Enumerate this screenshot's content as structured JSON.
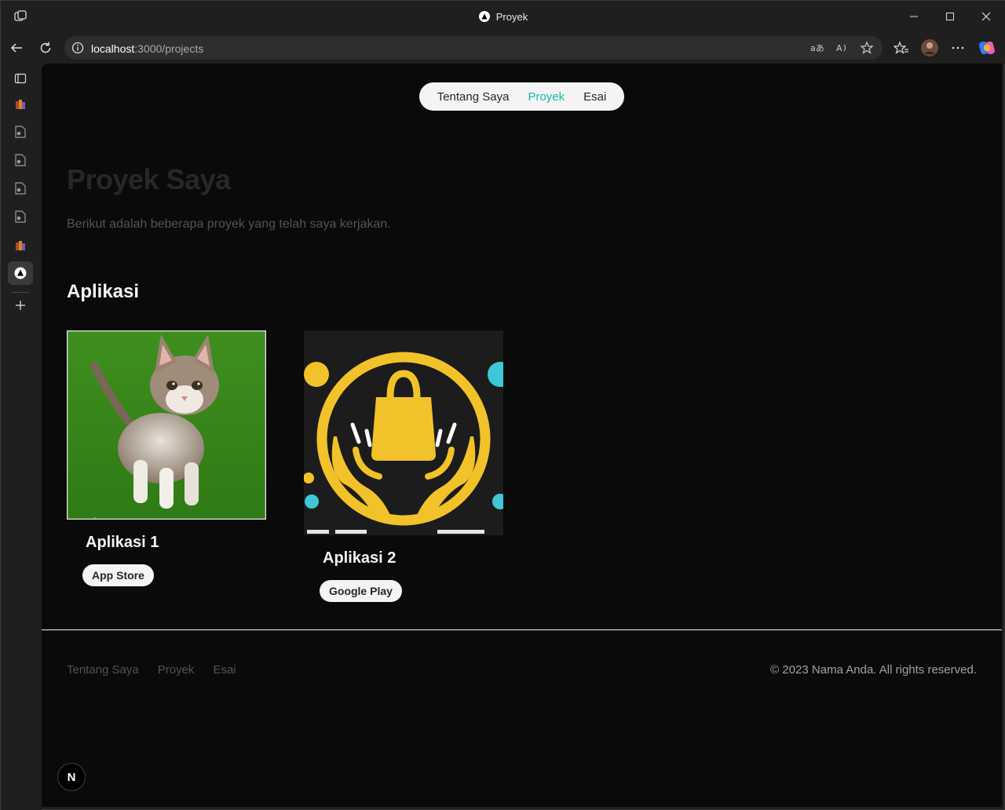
{
  "browser": {
    "tab_title": "Proyek",
    "url_host": "localhost",
    "url_path": ":3000/projects"
  },
  "nav": {
    "items": [
      {
        "label": "Tentang Saya"
      },
      {
        "label": "Proyek",
        "active": true
      },
      {
        "label": "Esai"
      }
    ]
  },
  "hero": {
    "title": "Proyek Saya",
    "description": "Berikut adalah beberapa proyek yang telah saya kerjakan."
  },
  "section": {
    "title": "Aplikasi",
    "cards": [
      {
        "title": "Aplikasi 1",
        "button": "App Store",
        "image": "kitten-photo"
      },
      {
        "title": "Aplikasi 2",
        "button": "Google Play",
        "image": "shopping-bag-hands-logo"
      }
    ]
  },
  "footer": {
    "links": [
      {
        "label": "Tentang Saya"
      },
      {
        "label": "Proyek"
      },
      {
        "label": "Esai"
      }
    ],
    "copyright": "© 2023 Nama Anda. All rights reserved."
  },
  "badge": {
    "label": "N"
  },
  "colors": {
    "accent": "#14b8a6",
    "page_bg": "#0a0a0a",
    "chrome_bg": "#1f1f1f"
  }
}
